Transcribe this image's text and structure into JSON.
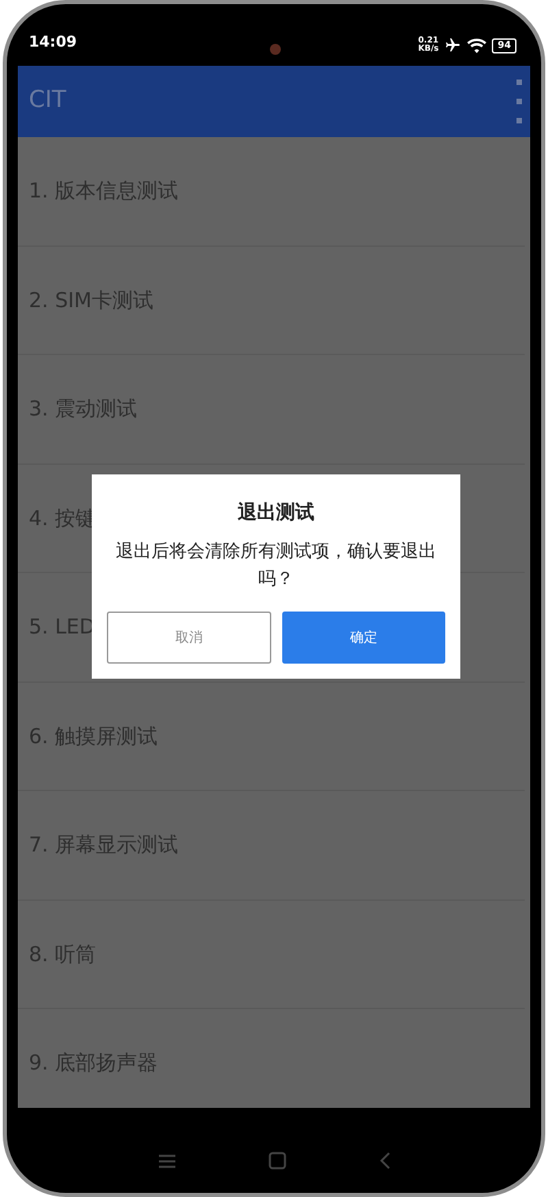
{
  "status_bar": {
    "time": "14:09",
    "net_speed": [
      "0.21",
      "KB/s"
    ],
    "battery": "94"
  },
  "app_bar": {
    "title": "CIT"
  },
  "test_items": [
    {
      "label": "1. 版本信息测试"
    },
    {
      "label": "2. SIM卡测试"
    },
    {
      "label": "3. 震动测试"
    },
    {
      "label": "4. 按键"
    },
    {
      "label": "5. LED"
    },
    {
      "label": "6. 触摸屏测试"
    },
    {
      "label": "7. 屏幕显示测试"
    },
    {
      "label": "8. 听筒"
    },
    {
      "label": "9. 底部扬声器"
    }
  ],
  "dialog": {
    "title": "退出测试",
    "message": "退出后将会清除所有测试项，确认要退出吗？",
    "buttons": [
      {
        "label": "取消",
        "kind": "secondary"
      },
      {
        "label": "确定",
        "kind": "primary"
      }
    ]
  }
}
